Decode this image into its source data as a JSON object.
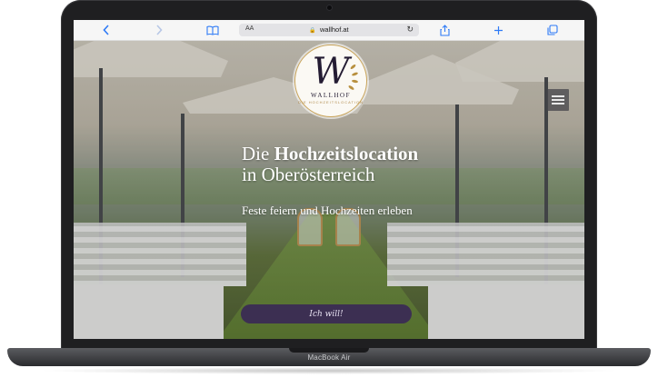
{
  "device": {
    "label": "MacBook Air"
  },
  "browser": {
    "text_size_label": "AA",
    "url": "wallhof.at",
    "icons": {
      "back": "chevron-left-icon",
      "forward": "chevron-right-icon",
      "reader": "book-icon",
      "lock": "lock-icon",
      "reload": "reload-icon",
      "share": "share-icon",
      "new_tab": "plus-icon",
      "tabs": "tabs-icon"
    },
    "accent": "#2f7bf6"
  },
  "site": {
    "logo": {
      "monogram": "W",
      "name": "WALLHOF",
      "subtitle": "DIE HOCHZEITSLOCATION"
    },
    "hero": {
      "title_prefix": "Die ",
      "title_bold": "Hochzeitslocation",
      "title_line2": "in Oberösterreich",
      "tagline": "Feste feiern und Hochzeiten erleben",
      "cta_label": "Ich will!"
    },
    "colors": {
      "cta": "#3c2f52",
      "logo_gold": "#c9a45a"
    }
  }
}
